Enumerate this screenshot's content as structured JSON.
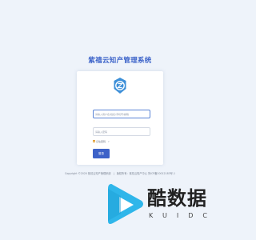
{
  "app": {
    "title": "紫禧云知产管理系统"
  },
  "login_form": {
    "username_placeholder": "请输入用户名/姓名/手机号/邮箱",
    "password_placeholder": "请输入密码",
    "remember_label": "记住密码",
    "help_icon": "?",
    "login_button_label": "登录"
  },
  "footer": {
    "copyright": "Copyright ©2020 紫禧云知产管理系统",
    "separator": "|",
    "icp": "版权所有：紫禧云知产中心 鲁ICP备20012183号-1"
  },
  "watermark": {
    "text": "酷数据",
    "subtext": "KUIDC"
  },
  "colors": {
    "accent": "#3d62c8",
    "background": "#eef3fa"
  }
}
